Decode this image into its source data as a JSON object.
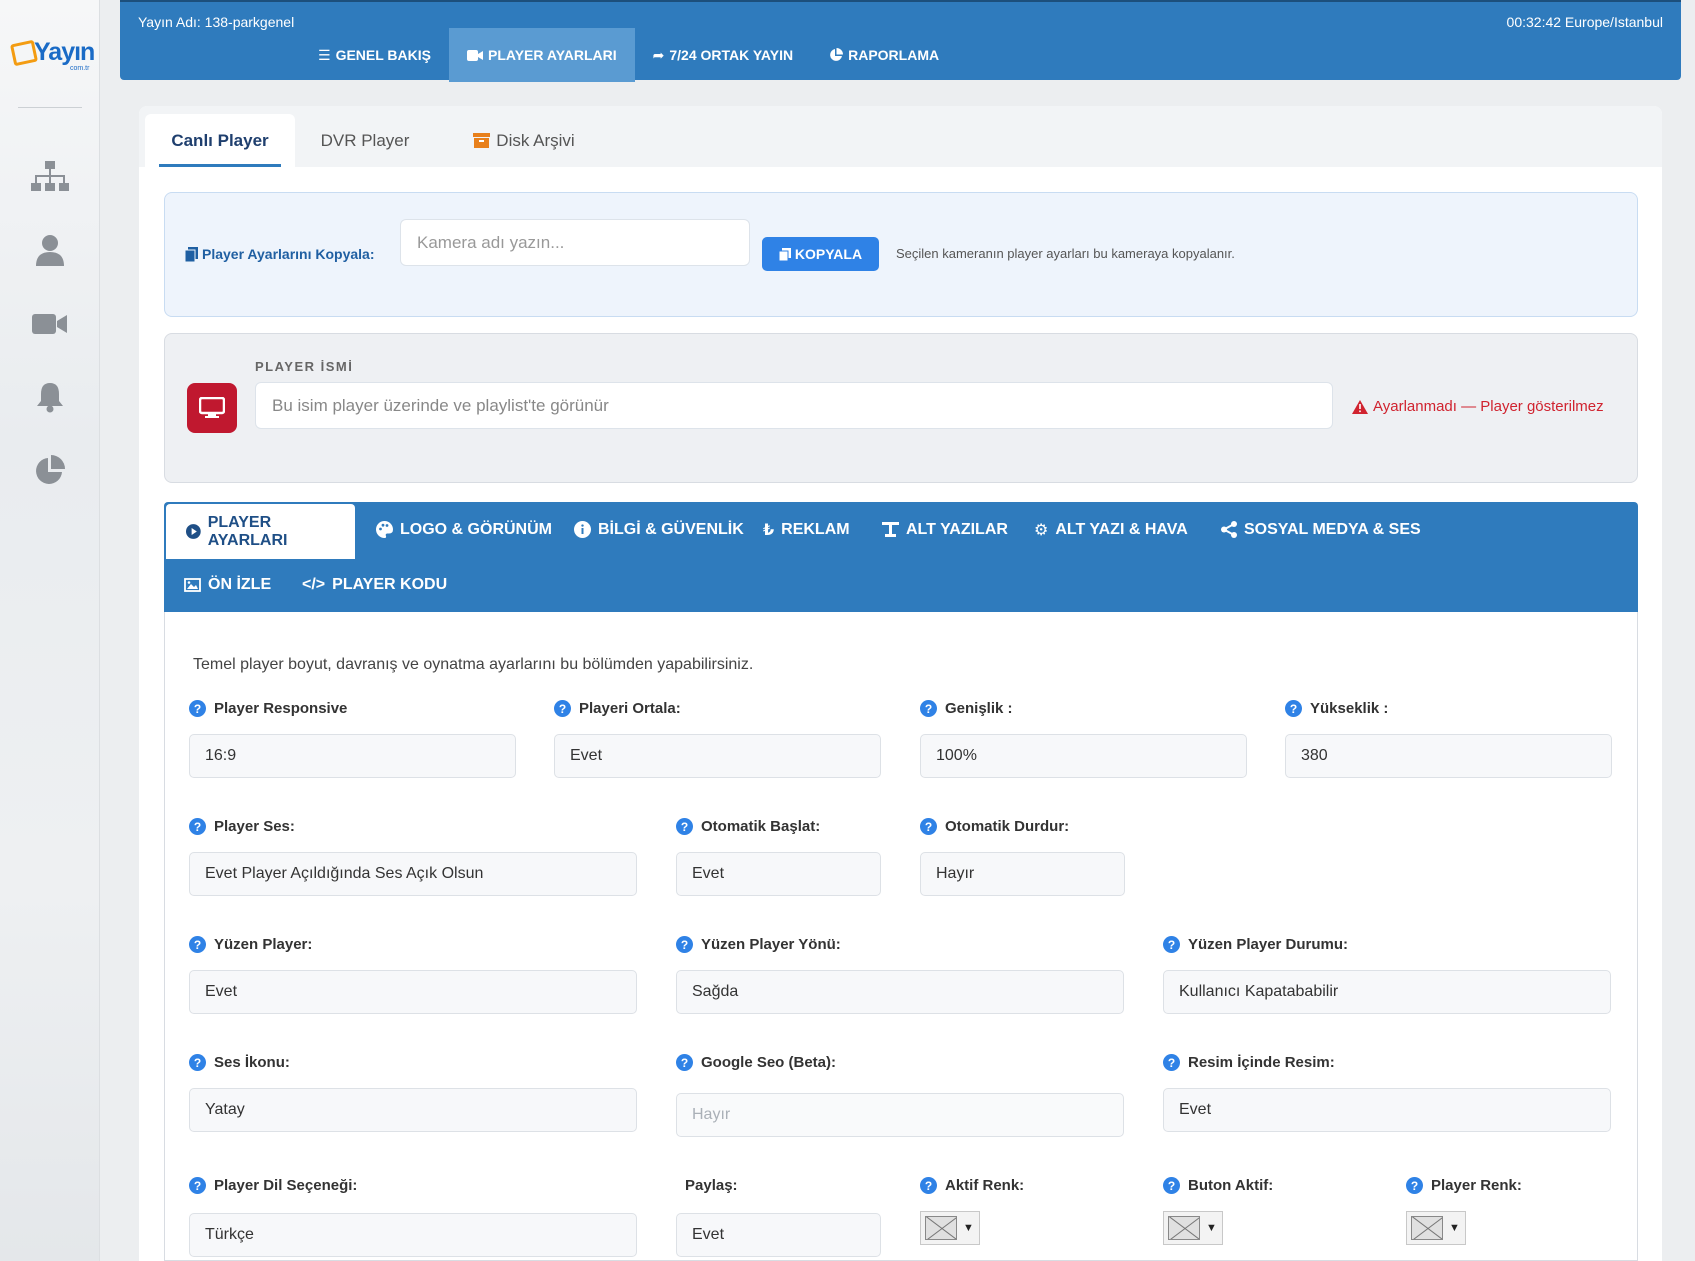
{
  "brand": {
    "name": "Yayın",
    "sub": "com.tr"
  },
  "topbar": {
    "title": "Yayın Adı: 138-parkgenel",
    "time": "00:32:42 Europe/Istanbul",
    "nav": [
      {
        "label": "GENEL BAKIŞ",
        "icon": "list-icon"
      },
      {
        "label": "PLAYER AYARLARI",
        "icon": "video-camera-icon",
        "active": true
      },
      {
        "label": "7/24 ORTAK YAYIN",
        "icon": "share-arrow-icon"
      },
      {
        "label": "RAPORLAMA",
        "icon": "pie-chart-icon"
      }
    ]
  },
  "sidebar": {
    "items": [
      "sitemap-icon",
      "user-icon",
      "video-camera-icon",
      "bell-icon",
      "pie-chart-icon"
    ]
  },
  "player_tabs": [
    {
      "label": "Canlı Player",
      "active": true
    },
    {
      "label": "DVR Player"
    },
    {
      "label": "Disk Arşivi",
      "icon": "archive-icon"
    }
  ],
  "copy": {
    "label": "Player Ayarlarını Kopyala:",
    "placeholder": "Kamera adı yazın...",
    "button": "KOPYALA",
    "note": "Seçilen kameranın player ayarları bu kameraya kopyalanır."
  },
  "player_name": {
    "label": "PLAYER İSMİ",
    "placeholder": "Bu isim player üzerinde ve playlist'te görünür",
    "warning": "Ayarlanmadı — Player gösterilmez"
  },
  "settings_tabs": [
    {
      "label": "PLAYER AYARLARI",
      "icon": "play-circle-icon",
      "active": true
    },
    {
      "label": "LOGO & GÖRÜNÜM",
      "icon": "palette-icon"
    },
    {
      "label": "BİLGİ & GÜVENLİK",
      "icon": "info-icon"
    },
    {
      "label": "REKLAM",
      "icon": "lira-icon"
    },
    {
      "label": "ALT YAZILAR",
      "icon": "text-icon"
    },
    {
      "label": "ALT YAZI & HAVA",
      "icon": "cogs-icon"
    },
    {
      "label": "SOSYAL MEDYA & SES",
      "icon": "share-nodes-icon"
    },
    {
      "label": "ÖN İZLE",
      "icon": "image-icon"
    },
    {
      "label": "PLAYER KODU",
      "icon": "code-icon"
    }
  ],
  "panel": {
    "intro": "Temel player boyut, davranış ve oynatma ayarlarını bu bölümden yapabilirsiniz.",
    "fields": {
      "responsive": {
        "label": "Player Responsive",
        "value": "16:9"
      },
      "center": {
        "label": "Playeri Ortala:",
        "value": "Evet"
      },
      "width": {
        "label": "Genişlik :",
        "value": "100%"
      },
      "height": {
        "label": "Yükseklik :",
        "value": "380"
      },
      "sound": {
        "label": "Player Ses:",
        "value": "Evet Player Açıldığında Ses Açık Olsun"
      },
      "autostart": {
        "label": "Otomatik Başlat:",
        "value": "Evet"
      },
      "autostop": {
        "label": "Otomatik Durdur:",
        "value": "Hayır"
      },
      "floating": {
        "label": "Yüzen Player:",
        "value": "Evet"
      },
      "floating_dir": {
        "label": "Yüzen Player Yönü:",
        "value": "Sağda"
      },
      "floating_state": {
        "label": "Yüzen Player Durumu:",
        "value": "Kullanıcı Kapatababilir"
      },
      "sound_icon": {
        "label": "Ses İkonu:",
        "value": "Yatay"
      },
      "google_seo": {
        "label": "Google Seo (Beta):",
        "value": "Hayır"
      },
      "pip": {
        "label": "Resim İçinde Resim:",
        "value": "Evet"
      },
      "language": {
        "label": "Player Dil Seçeneği:",
        "value": "Türkçe"
      },
      "share": {
        "label": "Paylaş:",
        "value": "Evet"
      },
      "active_color": {
        "label": "Aktif Renk:"
      },
      "button_active": {
        "label": "Buton Aktif:"
      },
      "player_color": {
        "label": "Player Renk:"
      }
    }
  },
  "colors": {
    "primary": "#2f7bbd",
    "accent_button": "#2f82e6",
    "danger": "#c0182f",
    "warning_text": "#d0232f"
  }
}
